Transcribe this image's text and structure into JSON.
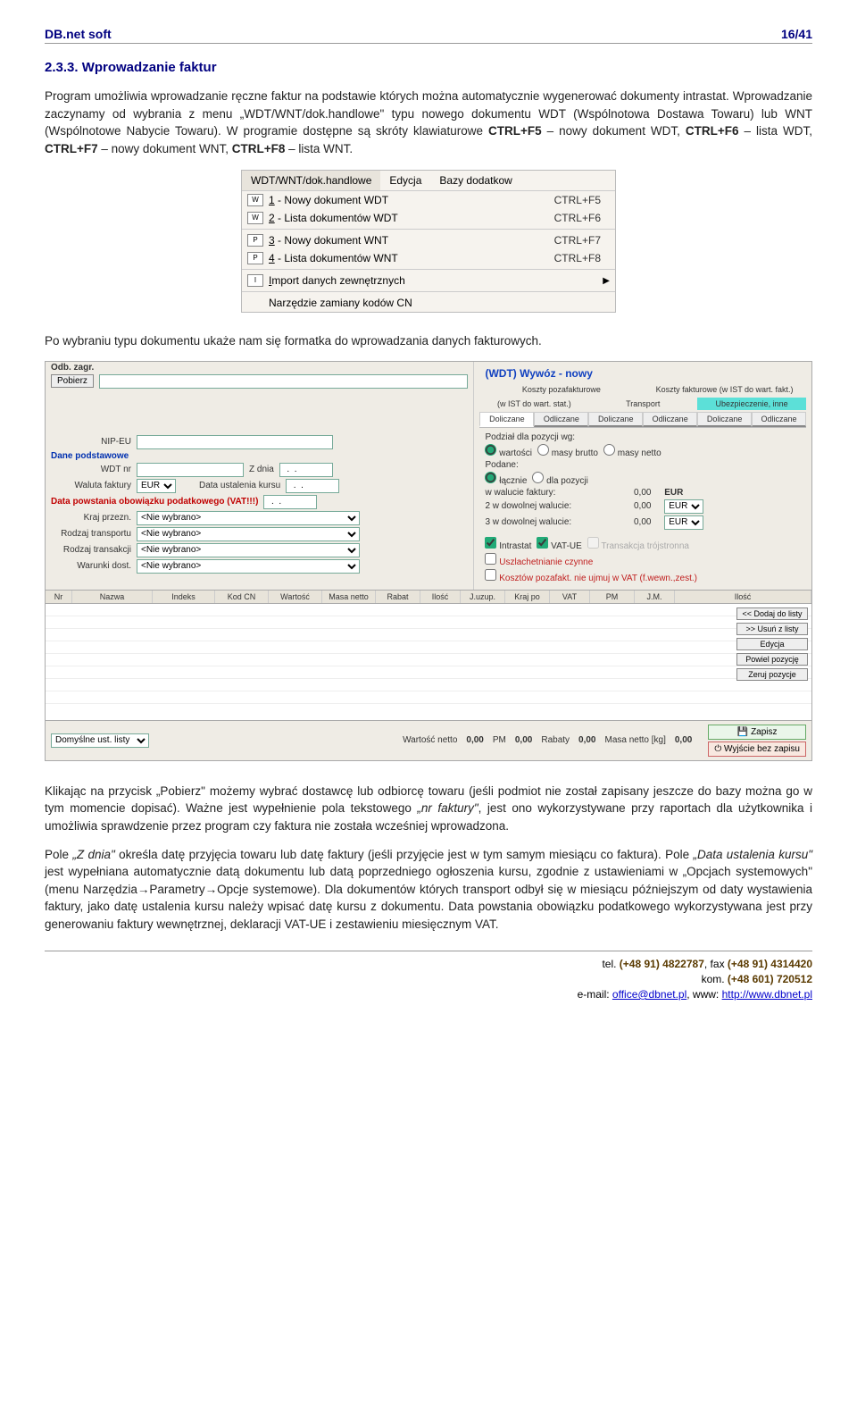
{
  "header": {
    "left": "DB.net soft",
    "right": "16/41"
  },
  "section_title": "2.3.3. Wprowadzanie faktur",
  "para1_a": "Program umożliwia wprowadzanie ręczne faktur na podstawie których można automatycznie wygenerować dokumenty intrastat. Wprowadzanie zaczynamy od wybrania z menu „WDT/WNT/dok.handlowe\" typu nowego dokumentu WDT (Wspólnotowa Dostawa Towaru) lub WNT (Wspólnotowe Nabycie Towaru). W programie dostępne są skróty klawiaturowe ",
  "ctrlf5": "CTRL+F5",
  "para1_b": " – nowy dokument WDT, ",
  "ctrlf6": "CTRL+F6",
  "para1_c": " – lista WDT, ",
  "ctrlf7": "CTRL+F7",
  "para1_d": " – nowy dokument WNT, ",
  "ctrlf8": "CTRL+F8",
  "para1_e": " – lista WNT.",
  "menu": {
    "bar": [
      "WDT/WNT/dok.handlowe",
      "Edycja",
      "Bazy dodatkow"
    ],
    "items": [
      {
        "ico": "W",
        "u": "1",
        "label": " - Nowy dokument WDT",
        "sc": "CTRL+F5"
      },
      {
        "ico": "W",
        "u": "2",
        "label": " - Lista dokumentów WDT",
        "sc": "CTRL+F6"
      },
      {
        "ico": "P",
        "u": "3",
        "label": " - Nowy dokument WNT",
        "sc": "CTRL+F7"
      },
      {
        "ico": "P",
        "u": "4",
        "label": " - Lista dokumentów WNT",
        "sc": "CTRL+F8"
      },
      {
        "ico": "I",
        "u": "I",
        "label": "mport danych zewnętrznych",
        "arrow": "▶"
      },
      {
        "label": "Narzędzie zamiany kodów CN"
      }
    ]
  },
  "para2": "Po wybraniu typu dokumentu ukaże nam się formatka do wprowadzania danych fakturowych.",
  "form": {
    "odb": "Odb. zagr.",
    "pobierz": "Pobierz",
    "title": "(WDT) Wywóz - nowy",
    "toptabs1": [
      "Koszty pozafakturowe",
      "Koszty fakturowe (w IST do wart. fakt.)"
    ],
    "toptabs2": [
      "(w IST do wart. stat.)",
      "Transport",
      "Ubezpieczenie, inne"
    ],
    "tabs": [
      "Doliczane",
      "Odliczane",
      "Doliczane",
      "Odliczane",
      "Doliczane",
      "Odliczane"
    ],
    "nip": "NIP-EU",
    "dane": "Dane podstawowe",
    "wdtnr": "WDT nr",
    "zdnia": "Z dnia",
    "waluta": "Waluta faktury",
    "waluta_v": "EUR",
    "dataust": "Data ustalenia kursu",
    "datapow": "Data powstania obowiązku podatkowego (VAT!!!)",
    "kraj": "Kraj przezn.",
    "nie": "<Nie wybrano>",
    "rodzt": "Rodzaj transportu",
    "rodztr": "Rodzaj transakcji",
    "war": "Warunki dost.",
    "podzial": "Podział dla pozycji wg:",
    "r_wart": "wartości",
    "r_brutto": "masy brutto",
    "r_netto": "masy netto",
    "podane": "Podane:",
    "r_lacz": "łącznie",
    "r_poz": "dla pozycji",
    "wfakt": "w walucie faktury:",
    "dow2": "2 w dowolnej walucie:",
    "dow3": "3 w dowolnej walucie:",
    "zero": "0,00",
    "eur": "EUR",
    "chk_intr": "Intrastat",
    "chk_vat": "VAT-UE",
    "chk_tr": "Transakcja trójstronna",
    "chk_usz": "Uszlachetnianie czynne",
    "chk_koszt": "Kosztów pozafakt. nie ujmuj w VAT (f.wewn.,zest.)",
    "grid": [
      "Nr",
      "Nazwa",
      "Indeks",
      "Kod CN",
      "Wartość",
      "Masa netto",
      "Rabat",
      "Ilość",
      "J.uzup.",
      "Kraj po",
      "VAT",
      "PM",
      "J.M.",
      "Ilość"
    ],
    "btns": [
      "<< Dodaj do listy",
      ">> Usuń z listy",
      "Edycja",
      "Powiel pozycję",
      "Zeruj pozycje"
    ],
    "footer_dom": "Domyślne ust. listy",
    "footer_wart": "Wartość netto",
    "footer_pm": "PM",
    "footer_rab": "Rabaty",
    "footer_masa": "Masa netto [kg]",
    "zapisz": "Zapisz",
    "wyjscie": "Wyjście bez zapisu"
  },
  "para3_a": "Klikając na przycisk „Pobierz\" możemy wybrać dostawcę lub odbiorcę towaru (jeśli podmiot nie został zapisany jeszcze do bazy można go w tym momencie dopisać). Ważne jest wypełnienie pola tekstowego ",
  "para3_i1": "„nr faktury\"",
  "para3_b": ", jest ono wykorzystywane przy raportach dla użytkownika i umożliwia sprawdzenie przez program czy faktura nie została wcześniej wprowadzona.",
  "para4_a": "Pole ",
  "para4_i1": "„Z dnia\"",
  "para4_b": " określa datę przyjęcia towaru lub datę faktury (jeśli przyjęcie jest w tym samym miesiącu co faktura). Pole ",
  "para4_i2": "„Data ustalenia kursu\"",
  "para4_c": " jest wypełniana automatycznie datą dokumentu lub datą poprzedniego ogłoszenia kursu, zgodnie z ustawieniami w „Opcjach systemowych\" (menu Narzędzia→Parametry→Opcje systemowe). Dla dokumentów których transport odbył się w miesiącu późniejszym od daty wystawienia faktury, jako datę ustalenia kursu należy wpisać datę kursu z dokumentu. Data powstania obowiązku podatkowego wykorzystywana jest przy generowaniu faktury wewnętrznej, deklaracji VAT-UE i zestawieniu miesięcznym VAT.",
  "footer": {
    "l1a": "tel. ",
    "l1b": "(+48 91) 4822787",
    "l1c": ", fax ",
    "l1d": "(+48 91) 4314420",
    "l2a": "kom. ",
    "l2b": "(+48 601) 720512",
    "l3a": "e-mail: ",
    "l3b": "office@dbnet.pl",
    "l3c": ", www: ",
    "l3d": "http://www.dbnet.pl"
  }
}
